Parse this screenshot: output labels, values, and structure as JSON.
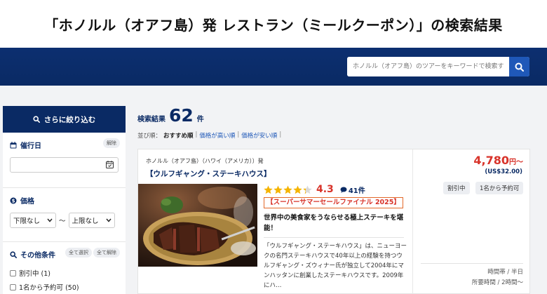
{
  "page_title": "「ホノルル（オアフ島）発 レストラン（ミールクーポン）」の検索結果",
  "search": {
    "placeholder": "ホノルル（オアフ島）のツアーをキーワードで検索する"
  },
  "sidebar": {
    "filter_title": "さらに絞り込む",
    "date": {
      "label": "催行日",
      "clear": "解除"
    },
    "price": {
      "label": "価格",
      "min": "下限なし",
      "tilde": "〜",
      "max": "上限なし"
    },
    "other": {
      "label": "その他条件",
      "select_all": "全て選択",
      "clear_all": "全て解除",
      "options": [
        "割引中 (1)",
        "1名から予約可 (50)"
      ]
    }
  },
  "results": {
    "label": "検索結果",
    "count": "62",
    "unit": "件",
    "sort": {
      "prefix": "並び順：",
      "options": [
        "おすすめ順",
        "価格が高い順",
        "価格が安い順"
      ],
      "sep": "|"
    }
  },
  "card": {
    "destination": "ホノルル（オアフ島）（ハワイ（アメリカ））発",
    "title": "【ウルフギャング・ステーキハウス】",
    "rating": "4.3",
    "rating_value": 4.3,
    "reviews": "41件",
    "promo": "【スーパーサマーセールファイナル 2025】",
    "catch": "世界中の美食家をうならせる極上ステーキを堪能！",
    "description": "「ウルフギャング・ステーキハウス」は、ニューヨークの名門ステーキハウスで40年以上の経験を持つウルフギャング・ズウィナー氏が独立して2004年にマンハッタンに創業したステーキハウスです。2009年にハ…",
    "price": "4,780",
    "price_suffix": "円〜",
    "price_usd": "(US$32.00)",
    "tags": [
      "割引中",
      "1名から予約可"
    ],
    "meta": [
      "時間帯 / 半日",
      "所要時間 / 2時間〜"
    ]
  },
  "colors": {
    "navy": "#0a2a64",
    "accent_red": "#d8332a",
    "star": "#f5b400"
  }
}
